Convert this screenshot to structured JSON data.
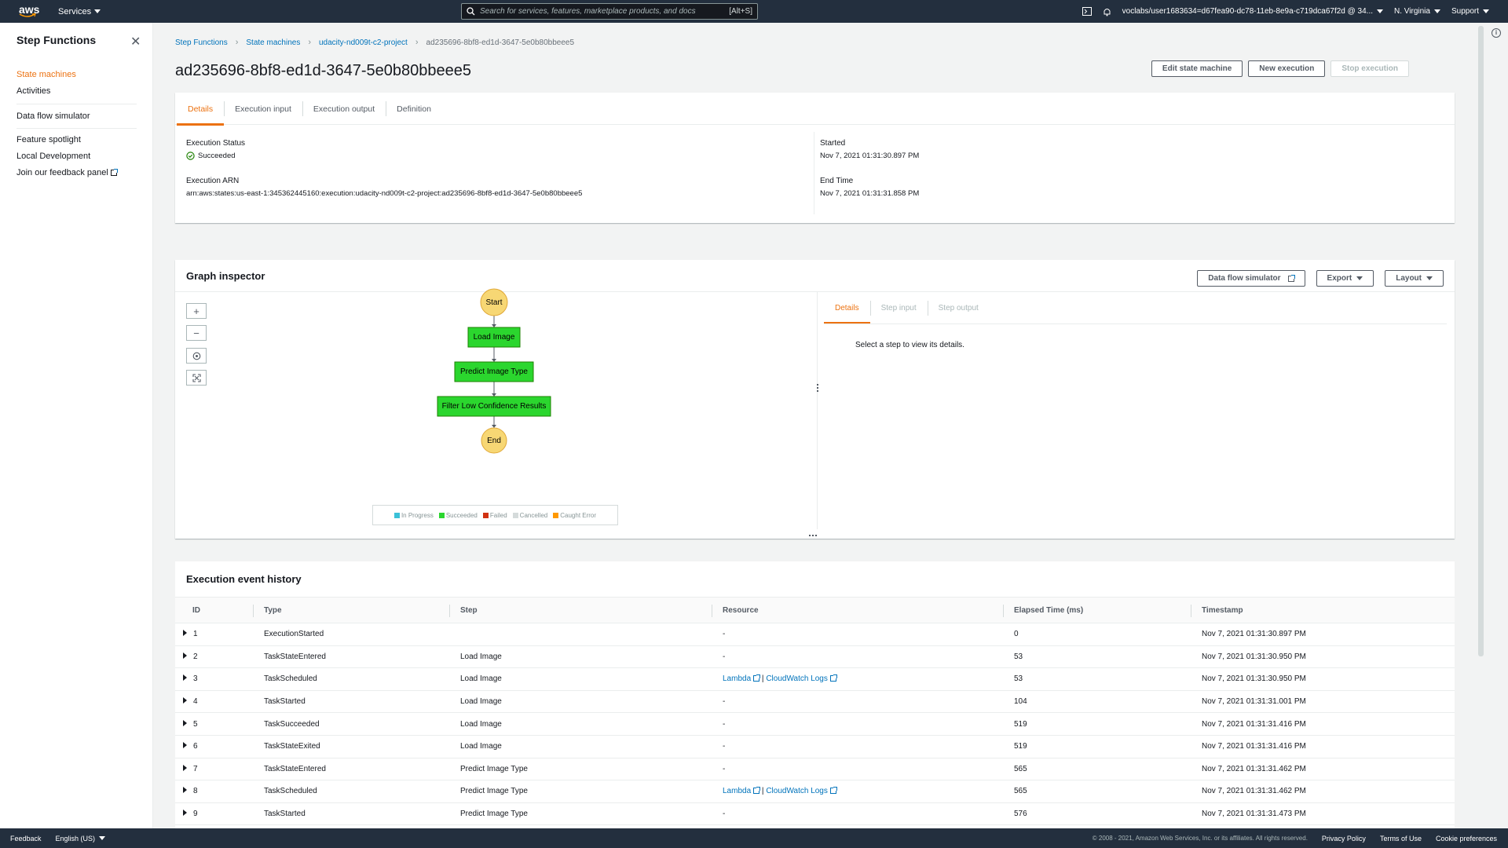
{
  "topnav": {
    "logo_text": "aws",
    "services": "Services",
    "search_placeholder": "Search for services, features, marketplace products, and docs",
    "search_shortcut": "[Alt+S]",
    "account": "voclabs/user1683634=d67fea90-dc78-11eb-8e9a-c719dca67f2d @ 34...",
    "region": "N. Virginia",
    "support": "Support"
  },
  "sidebar": {
    "title": "Step Functions",
    "items": [
      {
        "label": "State machines",
        "active": true
      },
      {
        "label": "Activities"
      },
      {
        "label": "Data flow simulator"
      },
      {
        "label": "Feature spotlight"
      },
      {
        "label": "Local Development"
      },
      {
        "label": "Join our feedback panel"
      }
    ]
  },
  "breadcrumb": [
    "Step Functions",
    "State machines",
    "udacity-nd009t-c2-project",
    "ad235696-8bf8-ed1d-3647-5e0b80bbeee5"
  ],
  "page_title": "ad235696-8bf8-ed1d-3647-5e0b80bbeee5",
  "header_buttons": {
    "edit": "Edit state machine",
    "new_execution": "New execution",
    "stop_execution": "Stop execution"
  },
  "details": {
    "tabs": [
      "Details",
      "Execution input",
      "Execution output",
      "Definition"
    ],
    "status_label": "Execution Status",
    "status_value": "Succeeded",
    "arn_label": "Execution ARN",
    "arn_value": "arn:aws:states:us-east-1:345362445160:execution:udacity-nd009t-c2-project:ad235696-8bf8-ed1d-3647-5e0b80bbeee5",
    "started_label": "Started",
    "started_value": "Nov 7, 2021 01:31:30.897 PM",
    "end_label": "End Time",
    "end_value": "Nov 7, 2021 01:31:31.858 PM"
  },
  "graph": {
    "title": "Graph inspector",
    "buttons": {
      "simulator": "Data flow simulator",
      "export": "Export",
      "layout": "Layout"
    },
    "nodes": [
      "Start",
      "Load Image",
      "Predict Image Type",
      "Filter Low Confidence Results",
      "End"
    ],
    "legend": [
      {
        "label": "In Progress",
        "color": "#3bc1d8"
      },
      {
        "label": "Succeeded",
        "color": "#2bd62e"
      },
      {
        "label": "Failed",
        "color": "#d13212"
      },
      {
        "label": "Cancelled",
        "color": "#d5dbdb"
      },
      {
        "label": "Caught Error",
        "color": "#ff9900"
      }
    ],
    "step_tabs": [
      "Details",
      "Step input",
      "Step output"
    ],
    "step_message": "Select a step to view its details."
  },
  "history": {
    "title": "Execution event history",
    "columns": [
      "ID",
      "Type",
      "Step",
      "Resource",
      "Elapsed Time (ms)",
      "Timestamp"
    ],
    "rows": [
      {
        "id": "1",
        "type": "ExecutionStarted",
        "step": "",
        "resource": "-",
        "elapsed": "0",
        "ts": "Nov 7, 2021 01:31:30.897 PM"
      },
      {
        "id": "2",
        "type": "TaskStateEntered",
        "step": "Load Image",
        "resource": "-",
        "elapsed": "53",
        "ts": "Nov 7, 2021 01:31:30.950 PM"
      },
      {
        "id": "3",
        "type": "TaskScheduled",
        "step": "Load Image",
        "resource": "links",
        "elapsed": "53",
        "ts": "Nov 7, 2021 01:31:30.950 PM"
      },
      {
        "id": "4",
        "type": "TaskStarted",
        "step": "Load Image",
        "resource": "-",
        "elapsed": "104",
        "ts": "Nov 7, 2021 01:31:31.001 PM"
      },
      {
        "id": "5",
        "type": "TaskSucceeded",
        "step": "Load Image",
        "resource": "-",
        "elapsed": "519",
        "ts": "Nov 7, 2021 01:31:31.416 PM"
      },
      {
        "id": "6",
        "type": "TaskStateExited",
        "step": "Load Image",
        "resource": "-",
        "elapsed": "519",
        "ts": "Nov 7, 2021 01:31:31.416 PM"
      },
      {
        "id": "7",
        "type": "TaskStateEntered",
        "step": "Predict Image Type",
        "resource": "-",
        "elapsed": "565",
        "ts": "Nov 7, 2021 01:31:31.462 PM"
      },
      {
        "id": "8",
        "type": "TaskScheduled",
        "step": "Predict Image Type",
        "resource": "links",
        "elapsed": "565",
        "ts": "Nov 7, 2021 01:31:31.462 PM"
      },
      {
        "id": "9",
        "type": "TaskStarted",
        "step": "Predict Image Type",
        "resource": "-",
        "elapsed": "576",
        "ts": "Nov 7, 2021 01:31:31.473 PM"
      }
    ],
    "lambda_link": "Lambda",
    "logs_link": "CloudWatch Logs",
    "link_separator": "|"
  },
  "footer": {
    "feedback": "Feedback",
    "language": "English (US)",
    "copyright": "© 2008 - 2021, Amazon Web Services, Inc. or its affiliates. All rights reserved.",
    "privacy": "Privacy Policy",
    "terms": "Terms of Use",
    "cookies": "Cookie preferences"
  }
}
